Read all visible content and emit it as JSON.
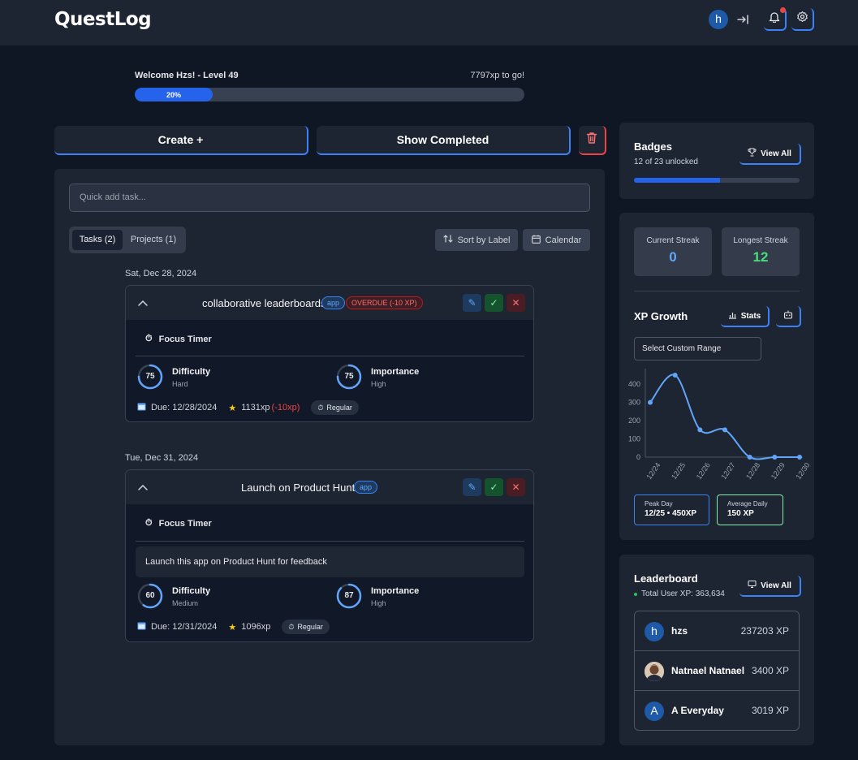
{
  "app": {
    "title": "QuestLog",
    "user_initial": "h"
  },
  "header": {
    "welcome": "Welcome Hzs! - Level 49",
    "xp_to_go": "7797xp to go!",
    "progress_label": "20%",
    "progress_value": 0.2
  },
  "actions": {
    "create_label": "Create +",
    "show_completed_label": "Show Completed"
  },
  "tasks_panel": {
    "quick_add_placeholder": "Quick add task...",
    "tabs": [
      {
        "label": "Tasks (2)",
        "active": true
      },
      {
        "label": "Projects (1)",
        "active": false
      }
    ],
    "sort_label": "Sort by Label",
    "calendar_label": "Calendar",
    "groups": [
      {
        "date": "Sat, Dec 28, 2024",
        "task": {
          "title": "collaborative leaderboards",
          "tag": "app",
          "overdue": "OVERDUE (-10 XP)",
          "focus_timer": "Focus Timer",
          "difficulty": {
            "label": "Difficulty",
            "value": "75",
            "level": "Hard",
            "fraction": 0.75
          },
          "importance": {
            "label": "Importance",
            "value": "75",
            "level": "High",
            "fraction": 0.75
          },
          "due": "Due: 12/28/2024",
          "xp": "1131xp",
          "xp_penalty": "(-10xp)",
          "frequency": "Regular"
        }
      },
      {
        "date": "Tue, Dec 31, 2024",
        "task": {
          "title": "Launch on Product Hunt!",
          "tag": "app",
          "focus_timer": "Focus Timer",
          "description": "Launch this app on Product Hunt for feedback",
          "difficulty": {
            "label": "Difficulty",
            "value": "60",
            "level": "Medium",
            "fraction": 0.6
          },
          "importance": {
            "label": "Importance",
            "value": "87",
            "level": "High",
            "fraction": 0.87
          },
          "due": "Due: 12/31/2024",
          "xp": "1096xp",
          "frequency": "Regular"
        }
      }
    ]
  },
  "badges": {
    "title": "Badges",
    "subtitle": "12 of 23 unlocked",
    "view_all": "View All",
    "progress": 0.52
  },
  "streaks": {
    "current_label": "Current Streak",
    "current_value": "0",
    "longest_label": "Longest Streak",
    "longest_value": "12"
  },
  "xp_growth": {
    "title": "XP Growth",
    "stats_label": "Stats",
    "range_placeholder": "Select Custom Range",
    "peak_label": "Peak Day",
    "peak_value": "12/25 • 450XP",
    "avg_label": "Average Daily",
    "avg_value": "150 XP",
    "colors": {
      "line": "#60a5fa",
      "peak_border": "#3b82f6",
      "avg_border": "#86efac"
    }
  },
  "chart_data": {
    "type": "line",
    "categories": [
      "12/24",
      "12/25",
      "12/26",
      "12/27",
      "12/28",
      "12/29",
      "12/30"
    ],
    "values": [
      300,
      450,
      150,
      150,
      0,
      0,
      0
    ],
    "yticks": [
      "0",
      "100",
      "200",
      "300",
      "400"
    ],
    "ylim": [
      0,
      450
    ],
    "grid": false
  },
  "leaderboard": {
    "title": "Leaderboard",
    "subtitle": "Total User XP: 363,634",
    "view_all": "View All",
    "entries": [
      {
        "initial": "h",
        "name": "hzs",
        "xp": "237203 XP",
        "avatar": "initial"
      },
      {
        "initial": "",
        "name": "Natnael Natnael",
        "xp": "3400 XP",
        "avatar": "photo"
      },
      {
        "initial": "A",
        "name": "A Everyday",
        "xp": "3019 XP",
        "avatar": "initial"
      }
    ]
  }
}
